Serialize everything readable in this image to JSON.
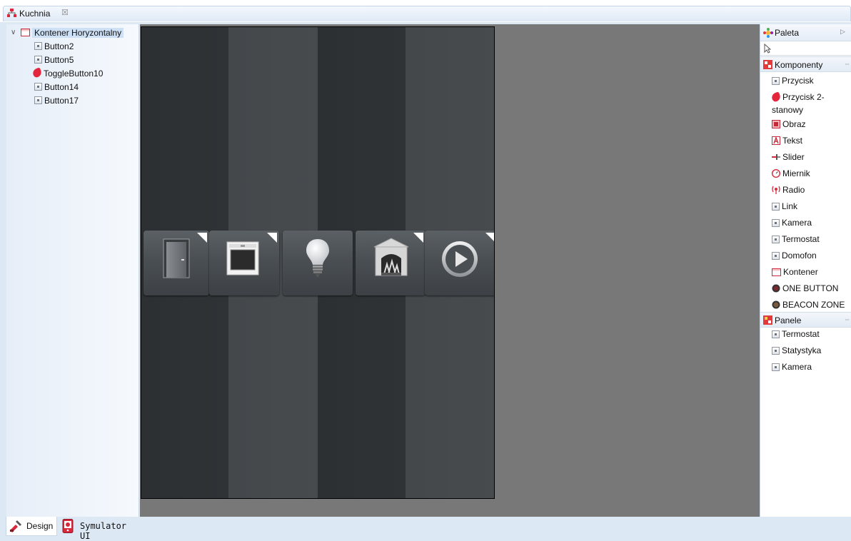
{
  "editor_tab": {
    "title": "Kuchnia",
    "close": "☒"
  },
  "outline": {
    "root": "Kontener Horyzontalny",
    "children": [
      "Button2",
      "Button5",
      "ToggleButton10",
      "Button14",
      "Button17"
    ]
  },
  "canvas": {
    "tiles": [
      "door-icon",
      "oven-icon",
      "lightbulb-icon",
      "fireplace-icon",
      "play-icon"
    ]
  },
  "palette": {
    "title": "Paleta",
    "drawers": [
      {
        "label": "Komponenty",
        "items": [
          "Przycisk",
          "Przycisk 2-stanowy",
          "Obraz",
          "Tekst",
          "Slider",
          "Miernik",
          "Radio",
          "Link",
          "Kamera",
          "Termostat",
          "Domofon",
          "Kontener",
          "ONE BUTTON",
          "BEACON ZONE"
        ]
      },
      {
        "label": "Panele",
        "items": [
          "Termostat",
          "Statystyka",
          "Kamera"
        ]
      }
    ]
  },
  "bottom_tabs": [
    "Design",
    "Symulator UI"
  ],
  "colors": {
    "canvas_bg": "#787878",
    "accent_red": "#e3263b",
    "selection": "#cde0f6"
  }
}
